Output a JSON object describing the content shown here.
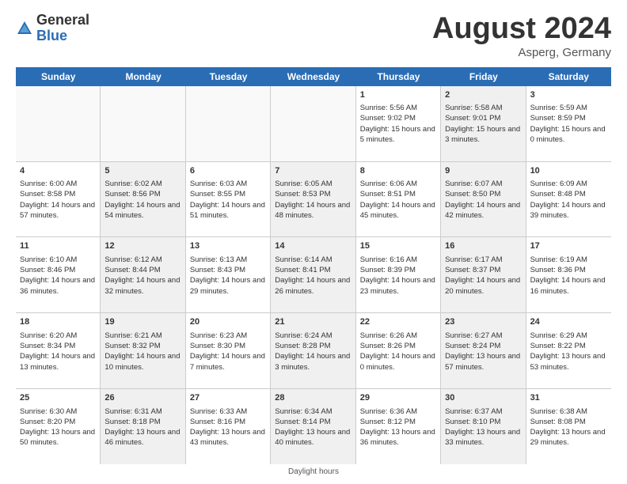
{
  "header": {
    "logo_line1": "General",
    "logo_line2": "Blue",
    "month": "August 2024",
    "location": "Asperg, Germany"
  },
  "days_of_week": [
    "Sunday",
    "Monday",
    "Tuesday",
    "Wednesday",
    "Thursday",
    "Friday",
    "Saturday"
  ],
  "footer": {
    "daylight_label": "Daylight hours"
  },
  "weeks": [
    [
      {
        "day": "",
        "sunrise": "",
        "sunset": "",
        "daylight": "",
        "shaded": false,
        "empty": true
      },
      {
        "day": "",
        "sunrise": "",
        "sunset": "",
        "daylight": "",
        "shaded": false,
        "empty": true
      },
      {
        "day": "",
        "sunrise": "",
        "sunset": "",
        "daylight": "",
        "shaded": false,
        "empty": true
      },
      {
        "day": "",
        "sunrise": "",
        "sunset": "",
        "daylight": "",
        "shaded": false,
        "empty": true
      },
      {
        "day": "1",
        "sunrise": "Sunrise: 5:56 AM",
        "sunset": "Sunset: 9:02 PM",
        "daylight": "Daylight: 15 hours and 5 minutes.",
        "shaded": false,
        "empty": false
      },
      {
        "day": "2",
        "sunrise": "Sunrise: 5:58 AM",
        "sunset": "Sunset: 9:01 PM",
        "daylight": "Daylight: 15 hours and 3 minutes.",
        "shaded": true,
        "empty": false
      },
      {
        "day": "3",
        "sunrise": "Sunrise: 5:59 AM",
        "sunset": "Sunset: 8:59 PM",
        "daylight": "Daylight: 15 hours and 0 minutes.",
        "shaded": false,
        "empty": false
      }
    ],
    [
      {
        "day": "4",
        "sunrise": "Sunrise: 6:00 AM",
        "sunset": "Sunset: 8:58 PM",
        "daylight": "Daylight: 14 hours and 57 minutes.",
        "shaded": false,
        "empty": false
      },
      {
        "day": "5",
        "sunrise": "Sunrise: 6:02 AM",
        "sunset": "Sunset: 8:56 PM",
        "daylight": "Daylight: 14 hours and 54 minutes.",
        "shaded": true,
        "empty": false
      },
      {
        "day": "6",
        "sunrise": "Sunrise: 6:03 AM",
        "sunset": "Sunset: 8:55 PM",
        "daylight": "Daylight: 14 hours and 51 minutes.",
        "shaded": false,
        "empty": false
      },
      {
        "day": "7",
        "sunrise": "Sunrise: 6:05 AM",
        "sunset": "Sunset: 8:53 PM",
        "daylight": "Daylight: 14 hours and 48 minutes.",
        "shaded": true,
        "empty": false
      },
      {
        "day": "8",
        "sunrise": "Sunrise: 6:06 AM",
        "sunset": "Sunset: 8:51 PM",
        "daylight": "Daylight: 14 hours and 45 minutes.",
        "shaded": false,
        "empty": false
      },
      {
        "day": "9",
        "sunrise": "Sunrise: 6:07 AM",
        "sunset": "Sunset: 8:50 PM",
        "daylight": "Daylight: 14 hours and 42 minutes.",
        "shaded": true,
        "empty": false
      },
      {
        "day": "10",
        "sunrise": "Sunrise: 6:09 AM",
        "sunset": "Sunset: 8:48 PM",
        "daylight": "Daylight: 14 hours and 39 minutes.",
        "shaded": false,
        "empty": false
      }
    ],
    [
      {
        "day": "11",
        "sunrise": "Sunrise: 6:10 AM",
        "sunset": "Sunset: 8:46 PM",
        "daylight": "Daylight: 14 hours and 36 minutes.",
        "shaded": false,
        "empty": false
      },
      {
        "day": "12",
        "sunrise": "Sunrise: 6:12 AM",
        "sunset": "Sunset: 8:44 PM",
        "daylight": "Daylight: 14 hours and 32 minutes.",
        "shaded": true,
        "empty": false
      },
      {
        "day": "13",
        "sunrise": "Sunrise: 6:13 AM",
        "sunset": "Sunset: 8:43 PM",
        "daylight": "Daylight: 14 hours and 29 minutes.",
        "shaded": false,
        "empty": false
      },
      {
        "day": "14",
        "sunrise": "Sunrise: 6:14 AM",
        "sunset": "Sunset: 8:41 PM",
        "daylight": "Daylight: 14 hours and 26 minutes.",
        "shaded": true,
        "empty": false
      },
      {
        "day": "15",
        "sunrise": "Sunrise: 6:16 AM",
        "sunset": "Sunset: 8:39 PM",
        "daylight": "Daylight: 14 hours and 23 minutes.",
        "shaded": false,
        "empty": false
      },
      {
        "day": "16",
        "sunrise": "Sunrise: 6:17 AM",
        "sunset": "Sunset: 8:37 PM",
        "daylight": "Daylight: 14 hours and 20 minutes.",
        "shaded": true,
        "empty": false
      },
      {
        "day": "17",
        "sunrise": "Sunrise: 6:19 AM",
        "sunset": "Sunset: 8:36 PM",
        "daylight": "Daylight: 14 hours and 16 minutes.",
        "shaded": false,
        "empty": false
      }
    ],
    [
      {
        "day": "18",
        "sunrise": "Sunrise: 6:20 AM",
        "sunset": "Sunset: 8:34 PM",
        "daylight": "Daylight: 14 hours and 13 minutes.",
        "shaded": false,
        "empty": false
      },
      {
        "day": "19",
        "sunrise": "Sunrise: 6:21 AM",
        "sunset": "Sunset: 8:32 PM",
        "daylight": "Daylight: 14 hours and 10 minutes.",
        "shaded": true,
        "empty": false
      },
      {
        "day": "20",
        "sunrise": "Sunrise: 6:23 AM",
        "sunset": "Sunset: 8:30 PM",
        "daylight": "Daylight: 14 hours and 7 minutes.",
        "shaded": false,
        "empty": false
      },
      {
        "day": "21",
        "sunrise": "Sunrise: 6:24 AM",
        "sunset": "Sunset: 8:28 PM",
        "daylight": "Daylight: 14 hours and 3 minutes.",
        "shaded": true,
        "empty": false
      },
      {
        "day": "22",
        "sunrise": "Sunrise: 6:26 AM",
        "sunset": "Sunset: 8:26 PM",
        "daylight": "Daylight: 14 hours and 0 minutes.",
        "shaded": false,
        "empty": false
      },
      {
        "day": "23",
        "sunrise": "Sunrise: 6:27 AM",
        "sunset": "Sunset: 8:24 PM",
        "daylight": "Daylight: 13 hours and 57 minutes.",
        "shaded": true,
        "empty": false
      },
      {
        "day": "24",
        "sunrise": "Sunrise: 6:29 AM",
        "sunset": "Sunset: 8:22 PM",
        "daylight": "Daylight: 13 hours and 53 minutes.",
        "shaded": false,
        "empty": false
      }
    ],
    [
      {
        "day": "25",
        "sunrise": "Sunrise: 6:30 AM",
        "sunset": "Sunset: 8:20 PM",
        "daylight": "Daylight: 13 hours and 50 minutes.",
        "shaded": false,
        "empty": false
      },
      {
        "day": "26",
        "sunrise": "Sunrise: 6:31 AM",
        "sunset": "Sunset: 8:18 PM",
        "daylight": "Daylight: 13 hours and 46 minutes.",
        "shaded": true,
        "empty": false
      },
      {
        "day": "27",
        "sunrise": "Sunrise: 6:33 AM",
        "sunset": "Sunset: 8:16 PM",
        "daylight": "Daylight: 13 hours and 43 minutes.",
        "shaded": false,
        "empty": false
      },
      {
        "day": "28",
        "sunrise": "Sunrise: 6:34 AM",
        "sunset": "Sunset: 8:14 PM",
        "daylight": "Daylight: 13 hours and 40 minutes.",
        "shaded": true,
        "empty": false
      },
      {
        "day": "29",
        "sunrise": "Sunrise: 6:36 AM",
        "sunset": "Sunset: 8:12 PM",
        "daylight": "Daylight: 13 hours and 36 minutes.",
        "shaded": false,
        "empty": false
      },
      {
        "day": "30",
        "sunrise": "Sunrise: 6:37 AM",
        "sunset": "Sunset: 8:10 PM",
        "daylight": "Daylight: 13 hours and 33 minutes.",
        "shaded": true,
        "empty": false
      },
      {
        "day": "31",
        "sunrise": "Sunrise: 6:38 AM",
        "sunset": "Sunset: 8:08 PM",
        "daylight": "Daylight: 13 hours and 29 minutes.",
        "shaded": false,
        "empty": false
      }
    ]
  ]
}
